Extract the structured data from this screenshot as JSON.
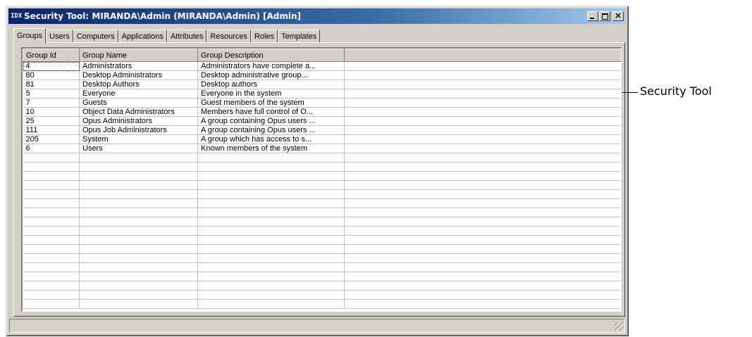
{
  "window": {
    "title": "Security Tool: MIRANDA\\Admin (MIRANDA\\Admin) [Admin]",
    "app_icon_glyph": "IDX",
    "icons": [
      "app-icon",
      "minimize-icon",
      "maximize-icon",
      "close-icon",
      "resize-grip-icon"
    ]
  },
  "tabs": [
    {
      "label": "Groups",
      "active": true
    },
    {
      "label": "Users",
      "active": false
    },
    {
      "label": "Computers",
      "active": false
    },
    {
      "label": "Applications",
      "active": false
    },
    {
      "label": "Attributes",
      "active": false
    },
    {
      "label": "Resources",
      "active": false
    },
    {
      "label": "Roles",
      "active": false
    },
    {
      "label": "Templates",
      "active": false
    }
  ],
  "table": {
    "columns": [
      "Group Id",
      "Group Name",
      "Group Description",
      ""
    ],
    "rows": [
      [
        "4",
        "Administrators",
        "Administrators have complete a..."
      ],
      [
        "80",
        "Desktop Administrators",
        "Desktop administrative group..."
      ],
      [
        "81",
        "Desktop Authors",
        "Desktop authors"
      ],
      [
        "5",
        "Everyone",
        "Everyone in the system"
      ],
      [
        "7",
        "Guests",
        "Guest members of the system"
      ],
      [
        "10",
        "Object Data Administrators",
        "Members have full control of O..."
      ],
      [
        "25",
        "Opus Administrators",
        "A group containing Opus users ..."
      ],
      [
        "111",
        "Opus Job Administrators",
        "A group containing Opus users ..."
      ],
      [
        "205",
        "System",
        "A group which has access to s..."
      ],
      [
        "6",
        "Users",
        "Known members of the system"
      ]
    ]
  },
  "callout": {
    "label": "Security Tool"
  },
  "colors": {
    "titlebar_start": "#0a246a",
    "titlebar_end": "#a6caf0",
    "window_face": "#d4d0c8"
  }
}
